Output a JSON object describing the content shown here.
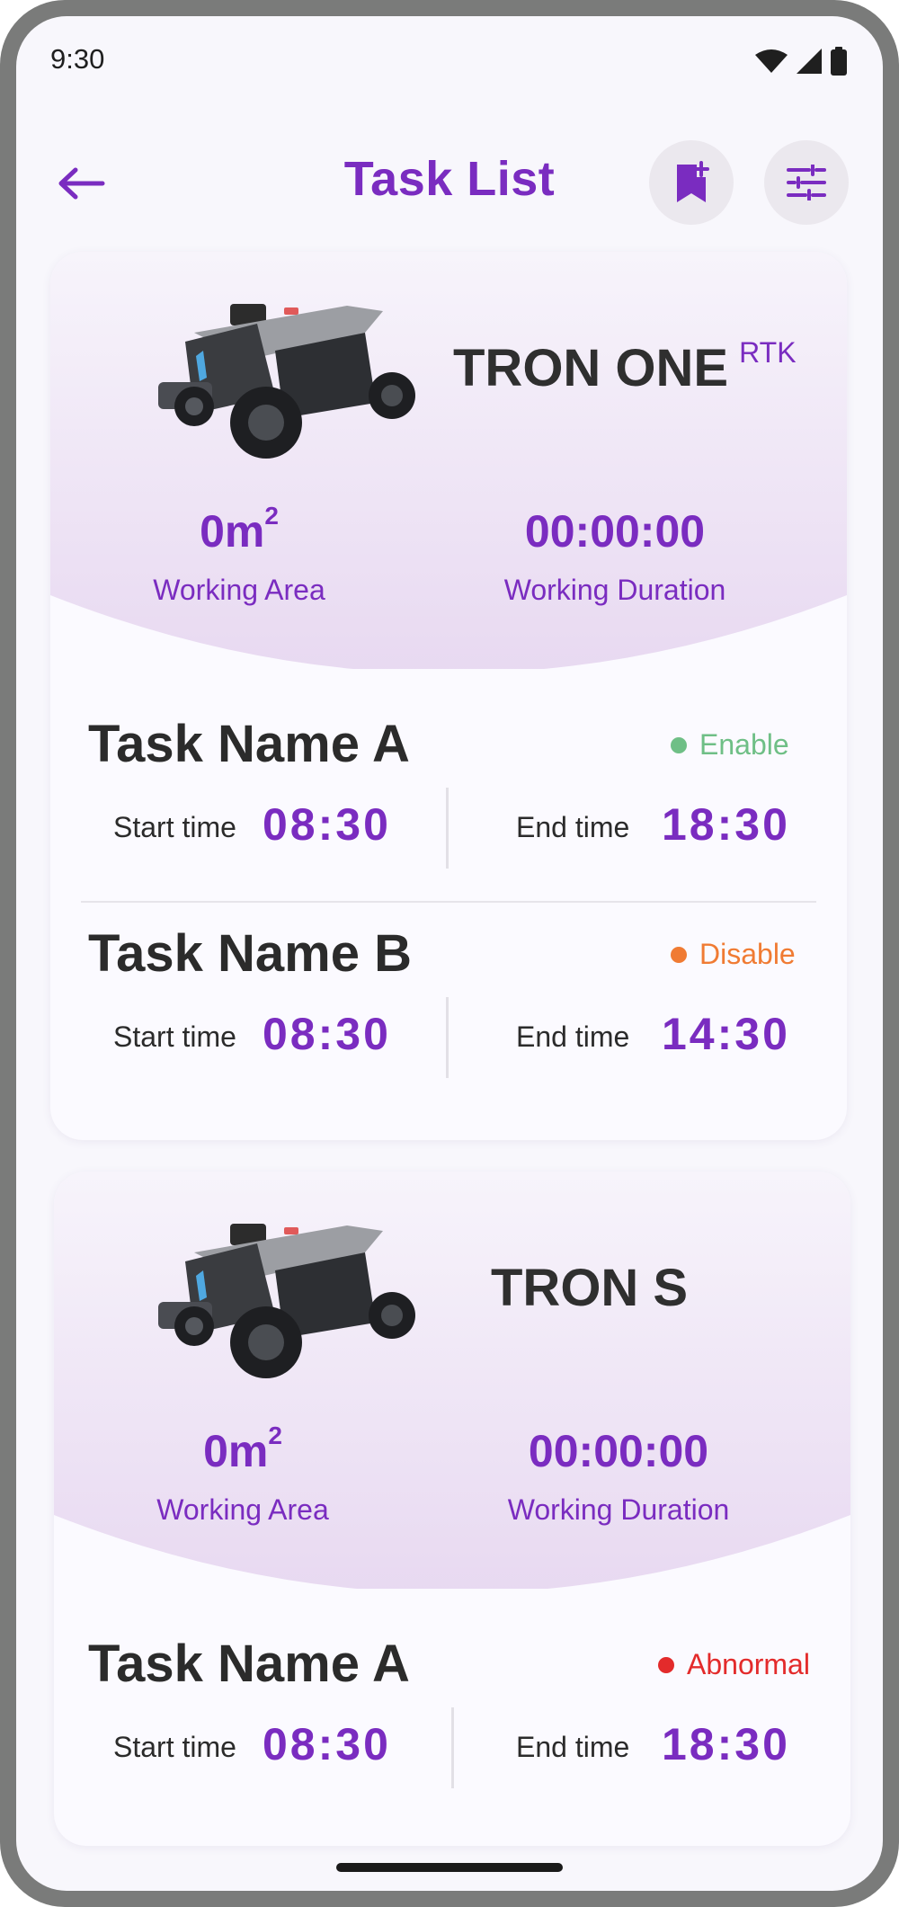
{
  "status_bar": {
    "time": "9:30"
  },
  "app_bar": {
    "title": "Task List",
    "icons": [
      "back-arrow-icon",
      "bookmark-add-icon",
      "filter-sliders-icon"
    ]
  },
  "colors": {
    "accent": "#7a2cc0",
    "enable": "#6fbf86",
    "disable": "#f07b33",
    "abnormal": "#e32b2b"
  },
  "devices": [
    {
      "name": "TRON ONE",
      "badge": "RTK",
      "area_value": "0m",
      "area_unit": "2",
      "area_label": "Working Area",
      "duration_value": "00:00:00",
      "duration_label": "Working Duration",
      "tasks": [
        {
          "name": "Task Name A",
          "status": "Enable",
          "start_label": "Start time",
          "start": "08:30",
          "end_label": "End time",
          "end": "18:30"
        },
        {
          "name": "Task Name B",
          "status": "Disable",
          "start_label": "Start time",
          "start": "08:30",
          "end_label": "End time",
          "end": "14:30"
        }
      ]
    },
    {
      "name": "TRON S",
      "badge": "",
      "area_value": "0m",
      "area_unit": "2",
      "area_label": "Working Area",
      "duration_value": "00:00:00",
      "duration_label": "Working Duration",
      "tasks": [
        {
          "name": "Task Name A",
          "status": "Abnormal",
          "start_label": "Start time",
          "start": "08:30",
          "end_label": "End time",
          "end": "18:30"
        }
      ]
    }
  ]
}
